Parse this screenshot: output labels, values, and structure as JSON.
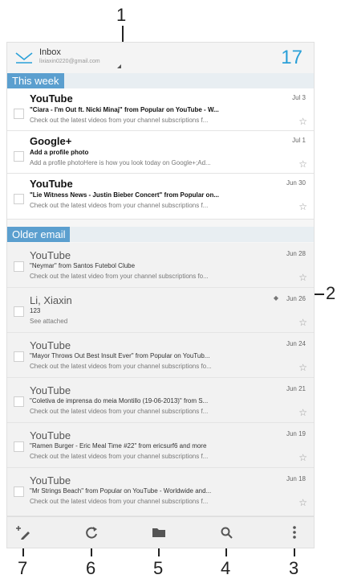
{
  "callouts": [
    "1",
    "2",
    "3",
    "4",
    "5",
    "6",
    "7"
  ],
  "header": {
    "title": "Inbox",
    "account": "lixiaxin0220@gmail.com",
    "unread_count": "17"
  },
  "sections": {
    "this_week": "This week",
    "older": "Older email"
  },
  "emails_new": [
    {
      "sender": "YouTube",
      "date": "Jul 3",
      "subject": "\"Ciara - I'm Out ft. Nicki Minaj\" from Popular on YouTube - W...",
      "preview": "Check out the latest videos from your channel subscriptions f..."
    },
    {
      "sender": "Google+",
      "date": "Jul 1",
      "subject": "Add a profile photo",
      "preview": "Add a profile photoHere is how you look today on Google+;Ad..."
    },
    {
      "sender": "YouTube",
      "date": "Jun 30",
      "subject": "\"Lie Witness News - Justin Bieber Concert\" from Popular on...",
      "preview": "Check out the latest videos from your channel subscriptions f..."
    }
  ],
  "emails_old": [
    {
      "sender": "YouTube",
      "date": "Jun 28",
      "subject": "\"Neymar\" from Santos Futebol Clube",
      "preview": "Check out the latest video from your channel subscriptions fo..."
    },
    {
      "sender": "Li, Xiaxin",
      "date": "Jun 26",
      "subject": "123",
      "preview": "See attached"
    },
    {
      "sender": "YouTube",
      "date": "Jun 24",
      "subject": "\"Mayor Throws Out Best Insult Ever\" from Popular on YouTub...",
      "preview": "Check out the latest videos from your channel subscriptions fo..."
    },
    {
      "sender": "YouTube",
      "date": "Jun 21",
      "subject": "\"Coletiva de imprensa do meia Montillo (19-06-2013)\" from S...",
      "preview": "Check out the latest videos from your channel subscriptions f..."
    },
    {
      "sender": "YouTube",
      "date": "Jun 19",
      "subject": "\"Ramen Burger - Eric Meal Time #22\" from ericsurf6 and more",
      "preview": "Check out the latest videos from your channel subscriptions f..."
    },
    {
      "sender": "YouTube",
      "date": "Jun 18",
      "subject": "\"Mr Strings Beach\" from Popular on YouTube - Worldwide and...",
      "preview": "Check out the latest videos from your channel subscriptions f..."
    }
  ],
  "toolbar": {
    "compose_icon": "compose-icon",
    "refresh_icon": "refresh-icon",
    "folder_icon": "folder-icon",
    "search_icon": "search-icon",
    "menu_icon": "overflow-menu-icon"
  },
  "colors": {
    "accent": "#2aa0d8",
    "section_tag": "#5b9fcf"
  }
}
